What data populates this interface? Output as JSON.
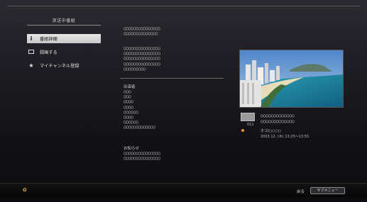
{
  "menu": {
    "title": "放送中番組",
    "items": [
      {
        "label": "番組詳細",
        "icon": "info-icon",
        "selected": true
      },
      {
        "label": "録画する",
        "icon": "record-icon",
        "selected": false
      },
      {
        "label": "マイチャンネル登録",
        "icon": "star-icon",
        "selected": false
      }
    ]
  },
  "details": {
    "block1": "○○○○○○○○○○○○○○○\n○○○○○○○○○○○○○○",
    "block2": "○○○○○○○○○○○○○○○\n○○○○○○○○○○○○○○○\n○○○○○○○○○○○○○○○\n○○○○○○○○○○○○○○○\n○○○○○○○○○",
    "cast_label": "出演者",
    "cast": "○○○\n○○○\n○○○○\n○○○○\n○○○○○○\n○○○○\n○○○○○○\n○○○○○○○○○○○○○",
    "notice_label": "お知らせ",
    "notice": "○○○○○○○○○○○○○○○\n○○○○○○○○○○○○○○○"
  },
  "program": {
    "channel_number": "011",
    "title": "○○○○○○○○○○○○○\n○○○○○○○○○○○○○",
    "channel_name": "ホゴ/○○○○",
    "datetime": "2003.12. (木)  13:25〜13:55"
  },
  "footer": {
    "back_label": "戻る",
    "submenu_label": "サブメニュー",
    "logo_text": "G"
  }
}
